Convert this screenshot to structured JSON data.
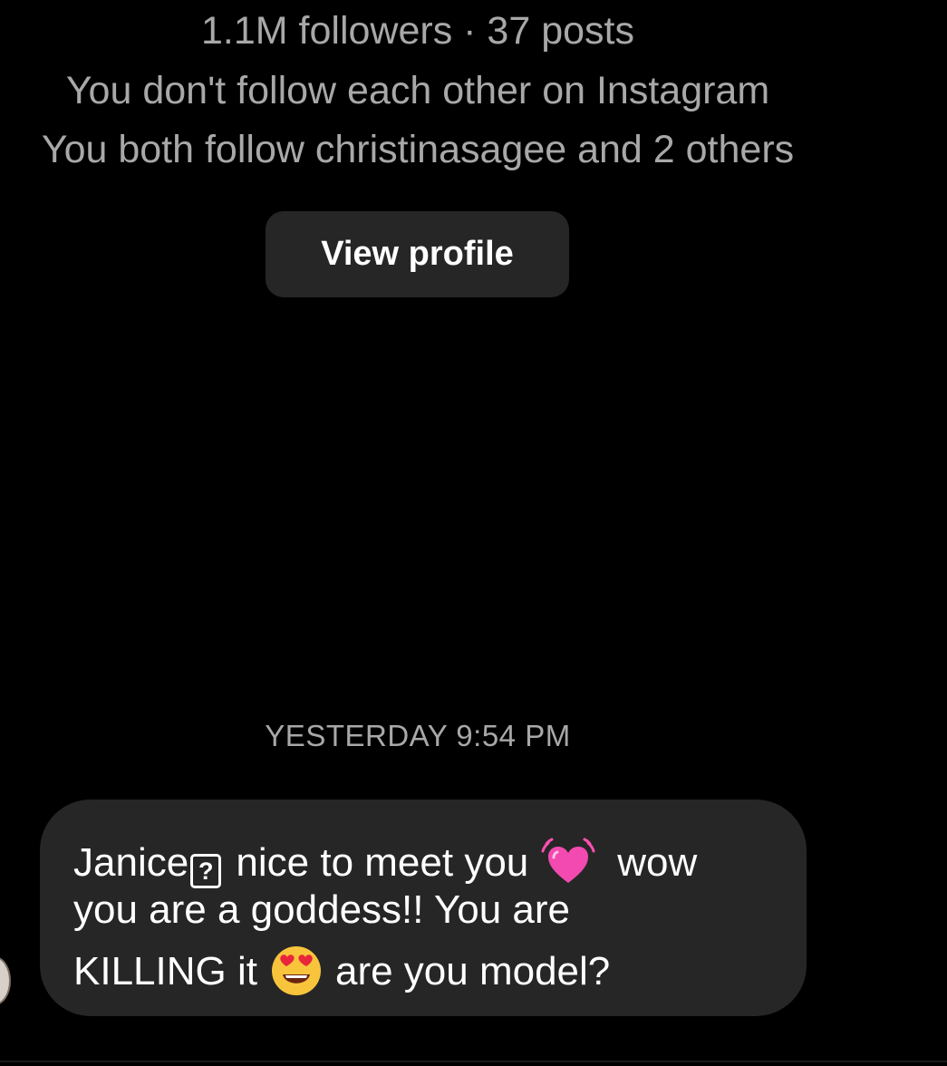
{
  "profile": {
    "stats_line": "1.1M followers · 37 posts",
    "follow_status": "You don't follow each other on Instagram",
    "mutual_follow": "You both follow christinasagee and 2 others",
    "view_profile_label": "View profile"
  },
  "thread": {
    "timestamp": "YESTERDAY 9:54 PM",
    "message": {
      "line1_name": "Janice",
      "unknown_glyph": "?",
      "line1_text": " nice to meet you",
      "line1_after": "wow",
      "line2_text": "you are a goddess!! You are",
      "line3_text_a": "KILLING it",
      "line3_text_b": "are you model?",
      "emoji_1": "heart-icon",
      "emoji_2": "heart-eyes-icon"
    }
  },
  "colors": {
    "background": "#000000",
    "secondary_text": "#a8a8a8",
    "bubble": "#262626",
    "button": "#262626",
    "primary_text": "#ffffff",
    "heart": "#ff4fb3"
  }
}
